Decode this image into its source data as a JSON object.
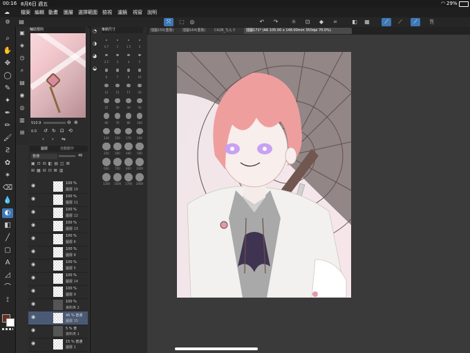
{
  "status_bar": {
    "time": "00:16",
    "date": "8月6日 週五",
    "battery": "29%"
  },
  "menu": [
    "檔案",
    "編輯",
    "動畫",
    "圖層",
    "選擇範圍",
    "檢視",
    "濾鏡",
    "視窗",
    "說明"
  ],
  "tabs": [
    {
      "label": "插圖150(重製)"
    },
    {
      "label": "插圖164(重製)"
    },
    {
      "label": "CA2B_ちんう"
    },
    {
      "label": "插圖171* (A6 105.00 x 148.00mm 350dpi 70.0%)"
    }
  ],
  "navigator": {
    "title": "輔助預則",
    "zoom": "510.9",
    "angle": "0.0"
  },
  "brush_panel": {
    "title": "筆刷尺寸",
    "sizes": [
      "0.7",
      "1",
      "1.5",
      "2",
      "2.5",
      "3",
      "4",
      "5",
      "6",
      "7",
      "8",
      "10",
      "12",
      "15",
      "17",
      "20",
      "25",
      "30",
      "40",
      "50",
      "60",
      "70",
      "80",
      "100",
      "120",
      "150",
      "170",
      "200",
      "250",
      "300",
      "400",
      "500",
      "600",
      "700",
      "800",
      "1000",
      "1200",
      "1500",
      "1700",
      "2000"
    ]
  },
  "layers_panel": {
    "title": "圖層",
    "tab2": "自動動作",
    "blend_mode": "普通",
    "opacity": "46",
    "layers": [
      {
        "pct": "100 %",
        "name": "圖層 10"
      },
      {
        "pct": "100 %",
        "name": "圖層 11"
      },
      {
        "pct": "100 %",
        "name": "圖層 12"
      },
      {
        "pct": "100 %",
        "name": "圖層 13"
      },
      {
        "pct": "100 %",
        "name": "圖層 6"
      },
      {
        "pct": "100 %",
        "name": "圖層 8"
      },
      {
        "pct": "100 %",
        "name": "圖層 5"
      },
      {
        "pct": "100 %",
        "name": "圖層 14"
      },
      {
        "pct": "100 %",
        "name": "圖層 9"
      },
      {
        "pct": "100 %",
        "name": "資料夾 2"
      },
      {
        "pct": "46 % 普通",
        "name": "圖層 15"
      },
      {
        "pct": "5 % 普",
        "name": "資料夾 1"
      },
      {
        "pct": "15 % 普通",
        "name": "圖層 1"
      }
    ]
  },
  "colors": {
    "accent": "#3e78b5",
    "main_color": "#6b2e22",
    "sub_color": "#ffffff"
  }
}
